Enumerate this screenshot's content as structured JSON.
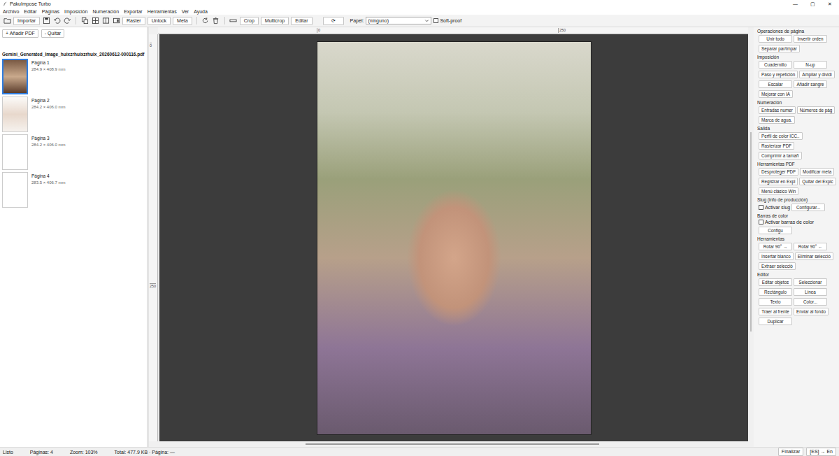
{
  "window": {
    "title": "PakuImpose Turbo",
    "controls": [
      "—",
      "▢",
      "✕"
    ]
  },
  "menu": [
    "Archivo",
    "Editar",
    "Páginas",
    "Imposición",
    "Numeración",
    "Exportar",
    "Herramientas",
    "Ver",
    "Ayuda"
  ],
  "toolbar": {
    "import": "Importar",
    "buttons_a": [
      "Raster",
      "Unlock",
      "Meta"
    ],
    "buttons_b": [
      "Crop",
      "Multicrop",
      "Editar"
    ],
    "refresh": "⟳",
    "paper_label": "Papel:",
    "paper_value": "(ninguno)",
    "softproof": {
      "label": "Soft-proof",
      "checked": false
    }
  },
  "files": {
    "add": "+ Añadir PDF",
    "remove": "- Quitar",
    "name": "Gemini_Generated_Image_huixzrhuixzrhuix_20260612-000116.pdf",
    "pages": [
      {
        "label": "Página 1",
        "size": "284.9 × 408.9 mm",
        "selected": true
      },
      {
        "label": "Página 2",
        "size": "284.2 × 406.0 mm",
        "selected": false
      },
      {
        "label": "Página 3",
        "size": "284.2 × 406.0 mm",
        "selected": false
      },
      {
        "label": "Página 4",
        "size": "283.5 × 406.7 mm",
        "selected": false
      }
    ]
  },
  "rulers": {
    "horizontal": [
      "0",
      "250"
    ],
    "vertical": [
      "0",
      "250"
    ]
  },
  "sidebar": {
    "sections": [
      {
        "title": "Operaciones de página",
        "kind": "buttons",
        "buttons": [
          "Unir todo",
          "Invertir orden",
          "Separar par/impar"
        ]
      },
      {
        "title": "Imposición",
        "kind": "buttons",
        "buttons": [
          "Cuadernillo",
          "N-up",
          "Paso y repetición",
          "Ampliar y dividi",
          "Escalar",
          "Añadir sangre",
          "Mejorar con IA"
        ]
      },
      {
        "title": "Numeración",
        "kind": "buttons",
        "buttons": [
          "Entradas numer",
          "Números de pág",
          "Marca de agua."
        ]
      },
      {
        "title": "Salida",
        "kind": "buttons",
        "buttons": [
          "Perfil de color ICC..",
          "Rasterizar PDF",
          "Comprimir a tamañ"
        ]
      },
      {
        "title": "Herramientas PDF",
        "kind": "buttons",
        "buttons": [
          "Desproteger PDF",
          "Modificar meta",
          "Registrar en Expl",
          "Quitar del Explc",
          "Menú clásico Win"
        ]
      },
      {
        "title": "Slug (info de producción)",
        "kind": "toggle",
        "checkbox": {
          "label": "Activar slug",
          "checked": false
        },
        "button": "Configurar..."
      },
      {
        "title": "Barras de color",
        "kind": "toggle",
        "checkbox": {
          "label": "Activar barras de color",
          "checked": false
        },
        "button": "Configu"
      },
      {
        "title": "Herramientas",
        "kind": "buttons",
        "buttons": [
          "Rotar 90° →",
          "Rotar 90° ←",
          "Insertar blanco",
          "Eliminar selecció",
          "Extraer selecció"
        ]
      },
      {
        "title": "Editor",
        "kind": "buttons",
        "buttons": [
          "Editar objetos",
          "Seleccionar",
          "Rectángulo",
          "Línea",
          "Texto",
          "Color...",
          "Traer al frente",
          "Enviar al fondo",
          "Duplicar"
        ]
      }
    ]
  },
  "status_bar": {
    "items": [
      "Listo",
      "Páginas: 4",
      "Zoom: 103%",
      "Total: 477.9 KB · Página: —"
    ],
    "finish": "Finalizar",
    "language": "[ES] → En"
  }
}
